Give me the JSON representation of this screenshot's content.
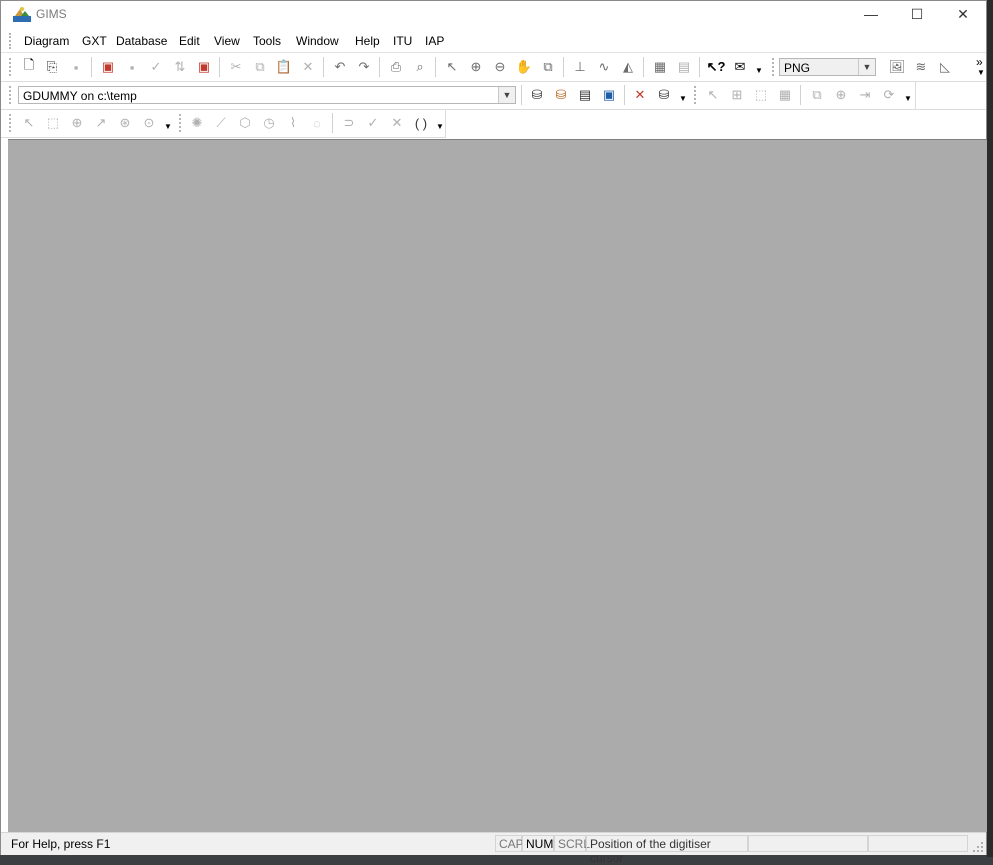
{
  "window": {
    "title": "GIMS",
    "controls": {
      "minimize": "—",
      "maximize": "☐",
      "close": "✕"
    }
  },
  "menubar": {
    "items": [
      "Diagram",
      "GXT",
      "Database",
      "Edit",
      "View",
      "Tools",
      "Window",
      "Help",
      "ITU",
      "IAP"
    ]
  },
  "toolbar1": {
    "format_combo_value": "PNG",
    "chevron": "»"
  },
  "toolbar2": {
    "database_combo_value": "GDUMMY on c:\\temp"
  },
  "statusbar": {
    "help_text": "For Help, press F1",
    "cap": "CAP",
    "num": "NUM",
    "scrl": "SCRL",
    "position_text": "Position of the digitiser cursor"
  },
  "colors": {
    "client_background": "#ababab",
    "window_background": "#ffffff",
    "statusbar_background": "#f0f0f0"
  }
}
